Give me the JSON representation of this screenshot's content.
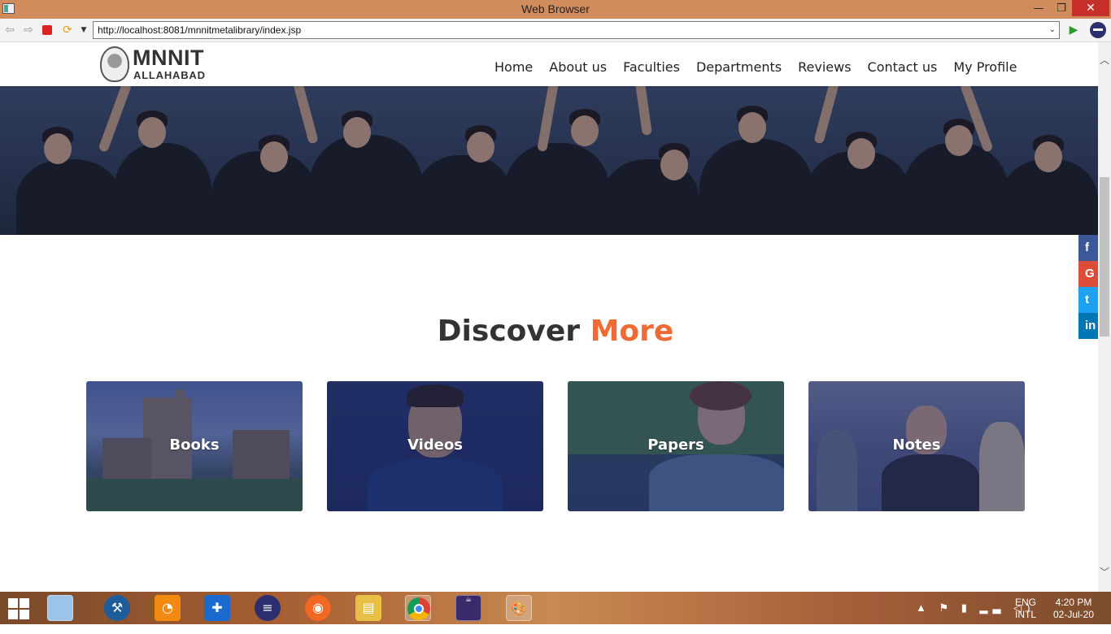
{
  "window": {
    "title": "Web Browser",
    "minimize_glyph": "—",
    "maximize_glyph": "❐",
    "close_glyph": "✕"
  },
  "toolbar": {
    "url": "http://localhost:8081/mnnitmetalibrary/index.jsp",
    "icons": [
      "back-arrow-icon",
      "forward-arrow-icon",
      "stop-icon",
      "refresh-icon",
      "dropdown-icon",
      "go-icon",
      "eclipse-icon"
    ]
  },
  "site": {
    "logo_main": "MNNIT",
    "logo_sub": "ALLAHABAD",
    "nav": [
      "Home",
      "About us",
      "Faculties",
      "Departments",
      "Reviews",
      "Contact us",
      "My Profile"
    ]
  },
  "social": [
    {
      "name": "facebook",
      "glyph": "f",
      "color": "#3b5998"
    },
    {
      "name": "google-plus",
      "glyph": "G",
      "color": "#dd4b39"
    },
    {
      "name": "twitter",
      "glyph": "t",
      "color": "#1da1f2"
    },
    {
      "name": "linkedin",
      "glyph": "in",
      "color": "#0077b5"
    }
  ],
  "discover": {
    "title_main": "Discover",
    "title_accent": "More",
    "accent_color": "#f06a35",
    "cards": [
      {
        "label": "Books"
      },
      {
        "label": "Videos"
      },
      {
        "label": "Papers"
      },
      {
        "label": "Notes"
      }
    ]
  },
  "taskbar": {
    "lang_line1": "ENG",
    "lang_line2": "INTL",
    "time": "4:20 PM",
    "date": "02-Jul-20"
  }
}
